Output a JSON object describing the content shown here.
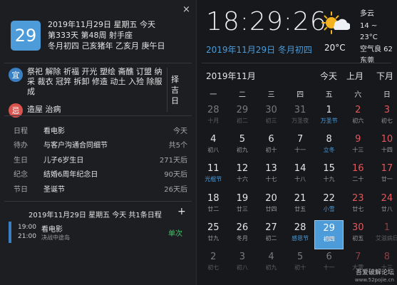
{
  "left": {
    "close_icon": "×",
    "day": "29",
    "lines": [
      "2019年11月29日 星期五 今天",
      "第333天 第48周 射手座",
      "冬月初四 己亥猪年 乙亥月 庚午日"
    ],
    "yi_label": "宜",
    "yi_text": "祭祀 解除 祈福 开光 塑绘 斋醮 订盟 纳采 裁衣 冠笄 拆卸 修造 动土 入殓 除服 成",
    "ji_label": "忌",
    "ji_text": "造屋 治病",
    "zeji": "择吉日",
    "events": [
      {
        "cat": "日程",
        "title": "看电影",
        "time": "今天"
      },
      {
        "cat": "待办",
        "title": "与客户沟通合同细节",
        "time": "共5个"
      },
      {
        "cat": "生日",
        "title": "儿子6岁生日",
        "time": "271天后"
      },
      {
        "cat": "纪念",
        "title": "结婚6周年纪念日",
        "time": "90天后"
      },
      {
        "cat": "节日",
        "title": "圣诞节",
        "time": "26天后"
      }
    ],
    "schedule_header": "2019年11月29日 星期五 今天 共1条日程",
    "plus": "+",
    "schedule": {
      "start": "19:00",
      "end": "21:00",
      "title": "看电影",
      "sub": "决战中途岛",
      "tag": "单次"
    }
  },
  "right": {
    "clock": "18:29:26",
    "date_lunar": "2019年11月29日 冬月初四",
    "temp": "20°C",
    "weather": [
      "多云",
      "14 ~ 23°C",
      "空气良 62",
      "东莞"
    ],
    "month_label": "2019年11月",
    "nav": {
      "today": "今天",
      "prev": "上月",
      "next": "下月"
    },
    "weekdays": [
      "一",
      "二",
      "三",
      "四",
      "五",
      "六",
      "日"
    ],
    "weeks": [
      [
        {
          "d": "28",
          "l": "十月",
          "o": 1
        },
        {
          "d": "29",
          "l": "初二",
          "o": 1
        },
        {
          "d": "30",
          "l": "初三",
          "o": 1
        },
        {
          "d": "31",
          "l": "万圣夜",
          "o": 1
        },
        {
          "d": "1",
          "l": "万圣节",
          "b": 1
        },
        {
          "d": "2",
          "l": "初六",
          "r": 1
        },
        {
          "d": "3",
          "l": "初七",
          "r": 1
        }
      ],
      [
        {
          "d": "4",
          "l": "初八"
        },
        {
          "d": "5",
          "l": "初九"
        },
        {
          "d": "6",
          "l": "初十"
        },
        {
          "d": "7",
          "l": "十一"
        },
        {
          "d": "8",
          "l": "立冬",
          "b": 1
        },
        {
          "d": "9",
          "l": "十三",
          "r": 1
        },
        {
          "d": "10",
          "l": "十四",
          "r": 1
        }
      ],
      [
        {
          "d": "11",
          "l": "光棍节",
          "b": 1
        },
        {
          "d": "12",
          "l": "十六"
        },
        {
          "d": "13",
          "l": "十七"
        },
        {
          "d": "14",
          "l": "十八"
        },
        {
          "d": "15",
          "l": "十九"
        },
        {
          "d": "16",
          "l": "二十",
          "r": 1
        },
        {
          "d": "17",
          "l": "廿一",
          "r": 1
        }
      ],
      [
        {
          "d": "18",
          "l": "廿二"
        },
        {
          "d": "19",
          "l": "廿三"
        },
        {
          "d": "20",
          "l": "廿四"
        },
        {
          "d": "21",
          "l": "廿五"
        },
        {
          "d": "22",
          "l": "小雪",
          "b": 1
        },
        {
          "d": "23",
          "l": "廿七",
          "r": 1
        },
        {
          "d": "24",
          "l": "廿八",
          "r": 1
        }
      ],
      [
        {
          "d": "25",
          "l": "廿九"
        },
        {
          "d": "26",
          "l": "冬月"
        },
        {
          "d": "27",
          "l": "初二"
        },
        {
          "d": "28",
          "l": "感恩节",
          "b": 1
        },
        {
          "d": "29",
          "l": "初四",
          "t": 1
        },
        {
          "d": "30",
          "l": "初五",
          "r": 1
        },
        {
          "d": "1",
          "l": "艾滋病日",
          "o": 1,
          "r": 1
        }
      ],
      [
        {
          "d": "2",
          "l": "初七",
          "o": 1
        },
        {
          "d": "3",
          "l": "初八",
          "o": 1
        },
        {
          "d": "4",
          "l": "初九",
          "o": 1
        },
        {
          "d": "5",
          "l": "初十",
          "o": 1
        },
        {
          "d": "6",
          "l": "十一",
          "o": 1
        },
        {
          "d": "7",
          "l": "大雪",
          "o": 1,
          "r": 1
        },
        {
          "d": "8",
          "l": "十三",
          "o": 1,
          "r": 1
        }
      ]
    ],
    "watermark": "吾爱破解论坛",
    "watermark_url": "www.52pojie.cn"
  }
}
